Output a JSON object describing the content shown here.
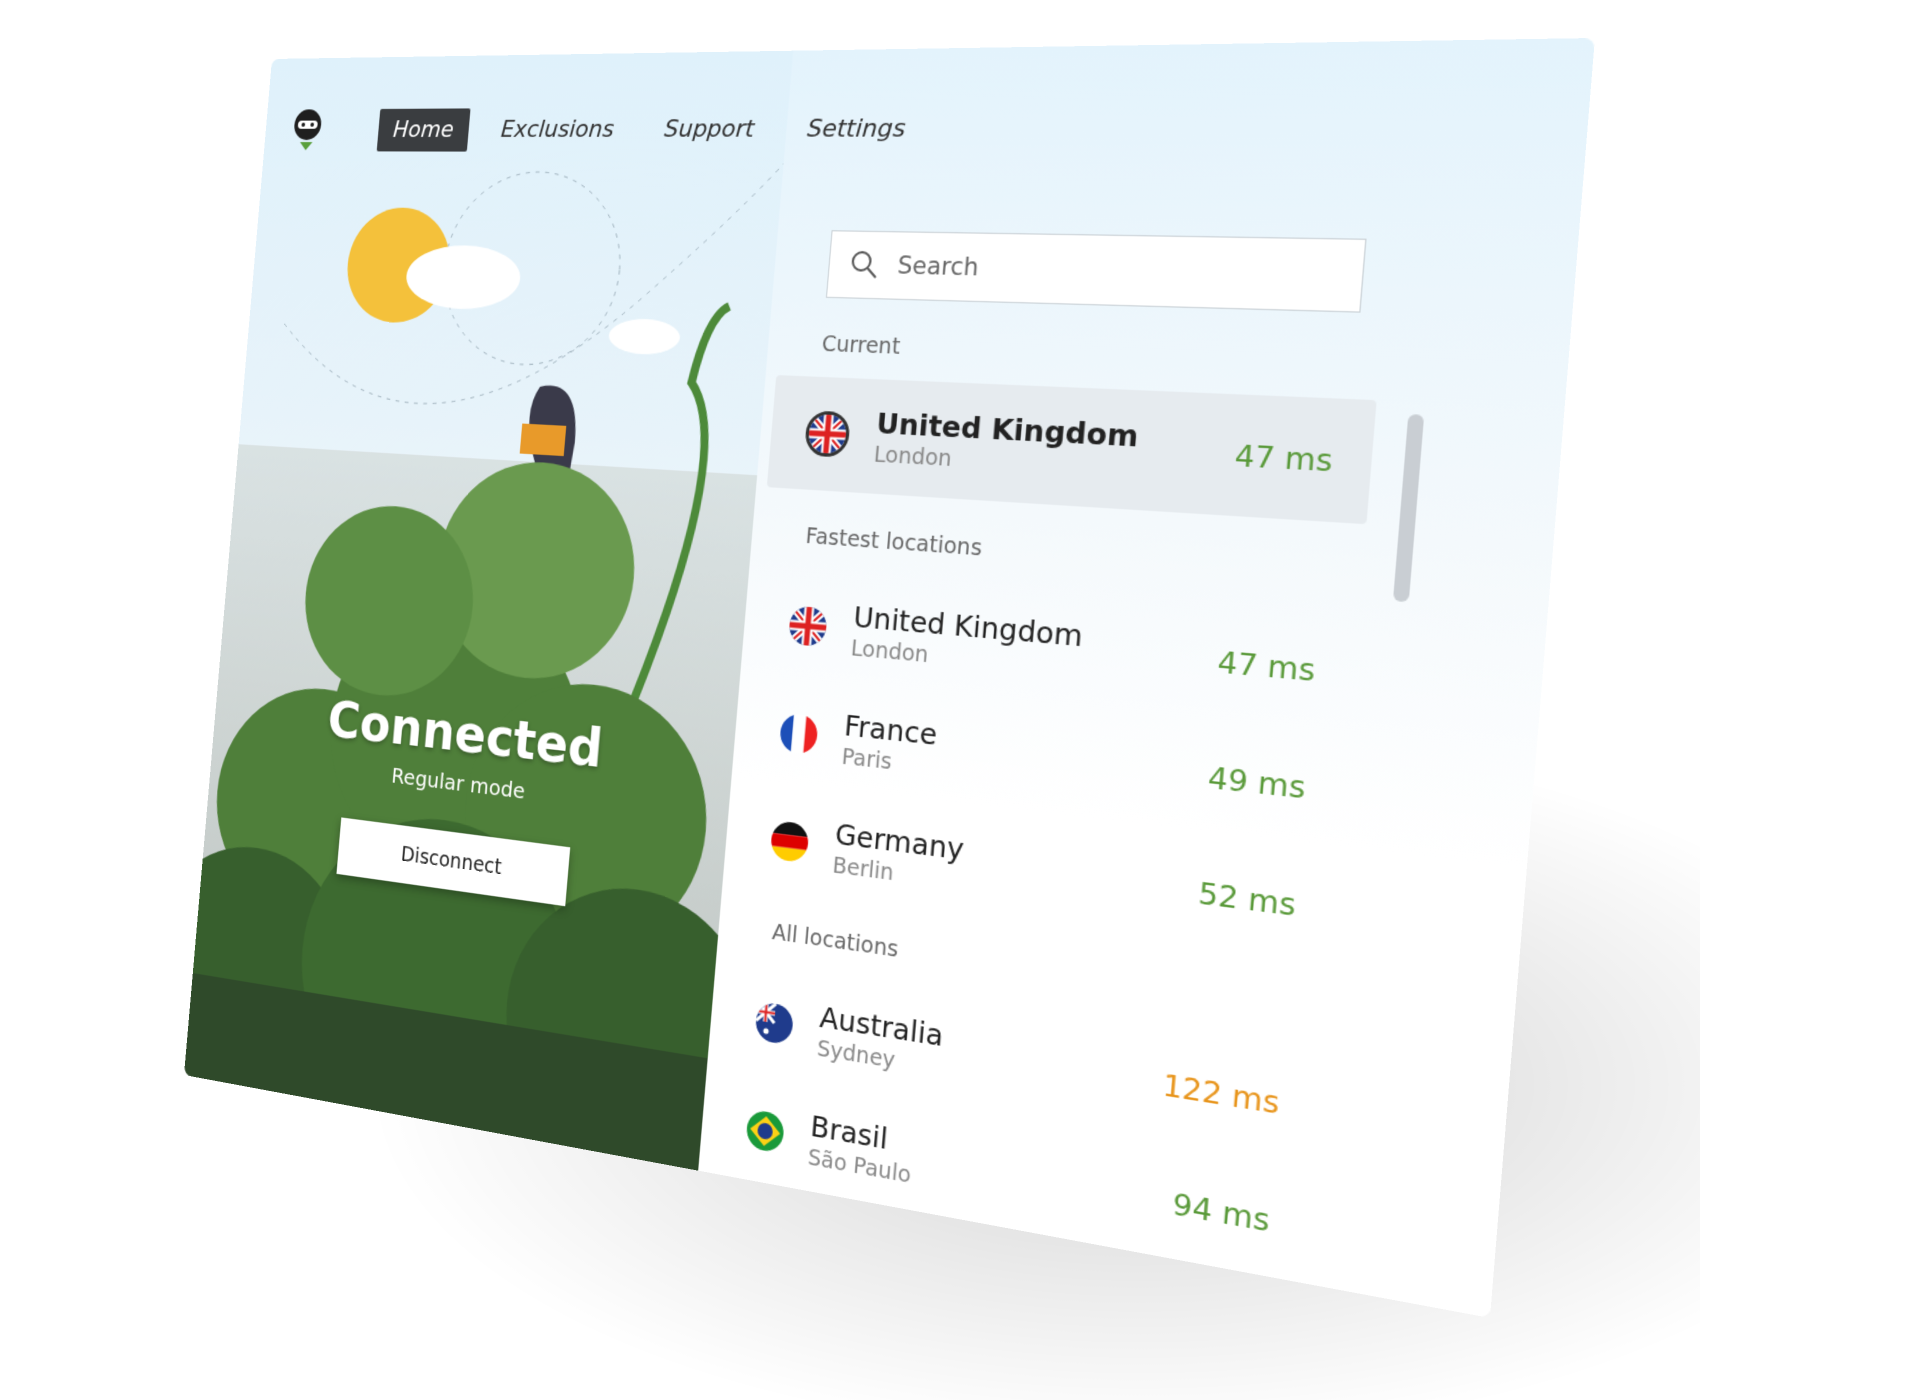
{
  "nav": {
    "items": [
      {
        "label": "Home",
        "active": true
      },
      {
        "label": "Exclusions"
      },
      {
        "label": "Support"
      },
      {
        "label": "Settings"
      }
    ]
  },
  "status": {
    "title": "Connected",
    "mode": "Regular mode",
    "disconnect_label": "Disconnect"
  },
  "search": {
    "placeholder": "Search",
    "value": ""
  },
  "sections": {
    "current": "Current",
    "fastest": "Fastest locations",
    "all": "All locations"
  },
  "current": {
    "country": "United Kingdom",
    "city": "London",
    "latency": "47 ms",
    "flag": "uk"
  },
  "fastest": [
    {
      "country": "United Kingdom",
      "city": "London",
      "latency": "47 ms",
      "flag": "uk"
    },
    {
      "country": "France",
      "city": "Paris",
      "latency": "49 ms",
      "flag": "fr"
    },
    {
      "country": "Germany",
      "city": "Berlin",
      "latency": "52 ms",
      "flag": "de"
    }
  ],
  "all": [
    {
      "country": "Australia",
      "city": "Sydney",
      "latency": "122 ms",
      "flag": "au"
    },
    {
      "country": "Brasil",
      "city": "São Paulo",
      "latency": "94 ms",
      "flag": "br"
    }
  ],
  "colors": {
    "latency_good": "#5a9a3a",
    "latency_slow": "#e8951c",
    "nav_active": "#3a3d40"
  }
}
